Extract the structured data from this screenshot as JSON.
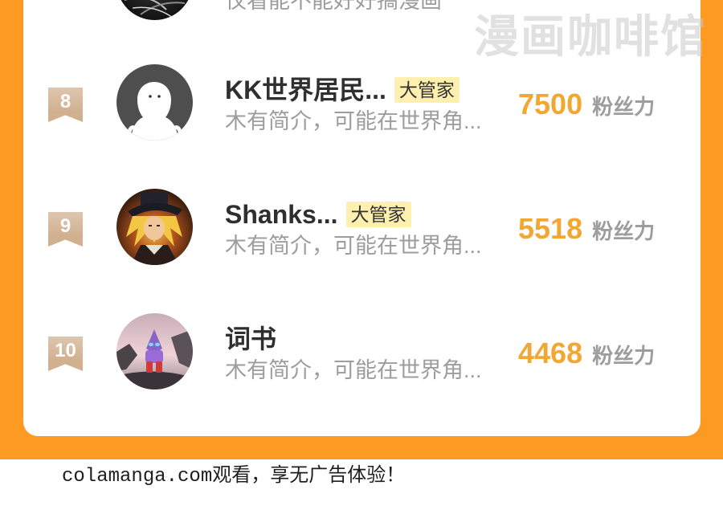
{
  "watermark": "漫画咖啡馆",
  "colors": {
    "page_background": "#FD9A21",
    "card_background": "#FFFFFF",
    "rank_badge": "#D1B090",
    "role_badge_background": "#FFF0B0",
    "fans_number": "#F2A733",
    "muted_text": "#9D9D9D",
    "name_text": "#2F2F2F"
  },
  "partial_row": {
    "avatar_icon": "user-avatar",
    "bio": "仅看能不能好好搞漫画"
  },
  "ranking": [
    {
      "rank": 8,
      "avatar_icon": "default-user-avatar",
      "name": "KK世界居民...",
      "role_badge": "大管家",
      "bio": "木有简介，可能在世界角...",
      "fans": 7500,
      "fans_label": "粉丝力"
    },
    {
      "rank": 9,
      "avatar_icon": "user-avatar",
      "name": "Shanks...",
      "role_badge": "大管家",
      "bio": "木有简介，可能在世界角...",
      "fans": 5518,
      "fans_label": "粉丝力"
    },
    {
      "rank": 10,
      "avatar_icon": "user-avatar",
      "name": "词书",
      "bio": "木有简介，可能在世界角...",
      "fans": 4468,
      "fans_label": "粉丝力"
    }
  ],
  "footer": {
    "text": "colamanga.com观看，享无广告体验！"
  }
}
